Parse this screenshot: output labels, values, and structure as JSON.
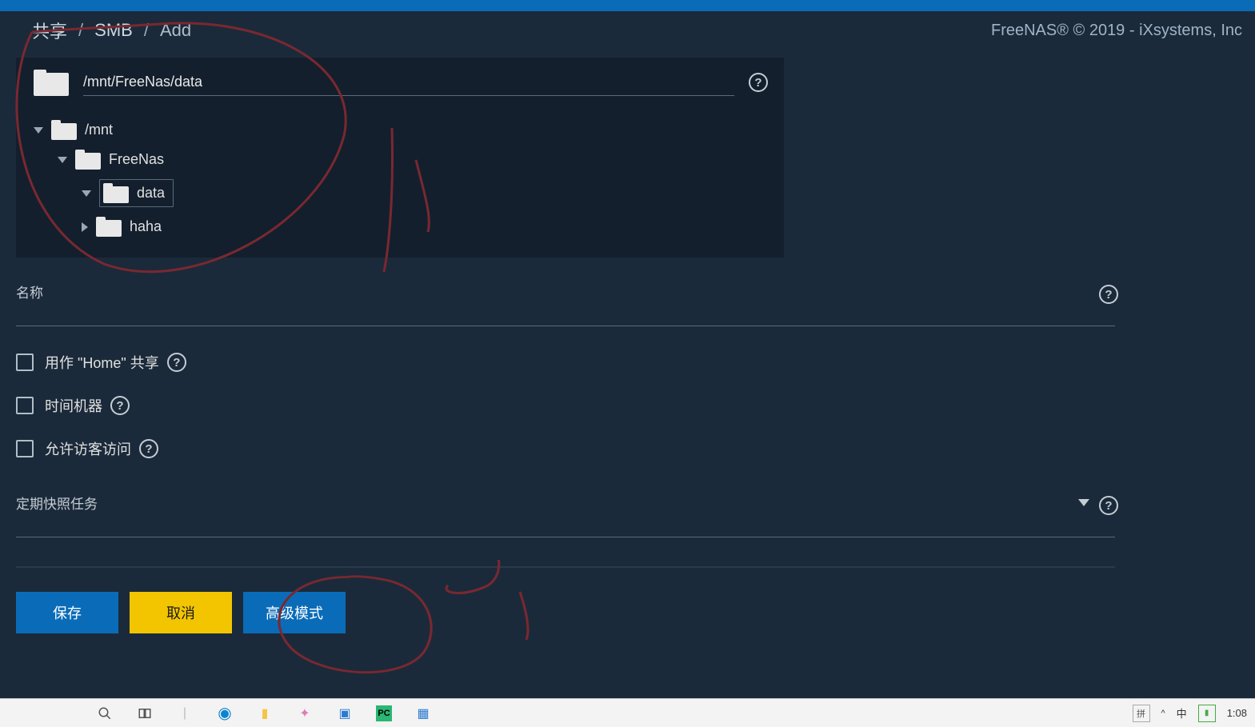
{
  "breadcrumb": {
    "items": [
      "共享",
      "SMB",
      "Add"
    ]
  },
  "copyright": "FreeNAS® © 2019 - iXsystems, Inc",
  "path": {
    "value": "/mnt/FreeNas/data"
  },
  "tree": {
    "root": {
      "label": "/mnt",
      "expanded": true,
      "children": [
        {
          "label": "FreeNas",
          "expanded": true,
          "children": [
            {
              "label": "data",
              "expanded": false,
              "selected": true
            },
            {
              "label": "haha",
              "expanded": false,
              "selected": false
            }
          ]
        }
      ]
    }
  },
  "fields": {
    "name_label": "名称",
    "use_home_label": "用作 \"Home\" 共享",
    "time_machine_label": "时间机器",
    "guest_access_label": "允许访客访问",
    "snapshot_task_label": "定期快照任务"
  },
  "buttons": {
    "save": "保存",
    "cancel": "取消",
    "advanced": "高级模式"
  },
  "taskbar": {
    "ime_lang": "中",
    "time": "1:08"
  }
}
